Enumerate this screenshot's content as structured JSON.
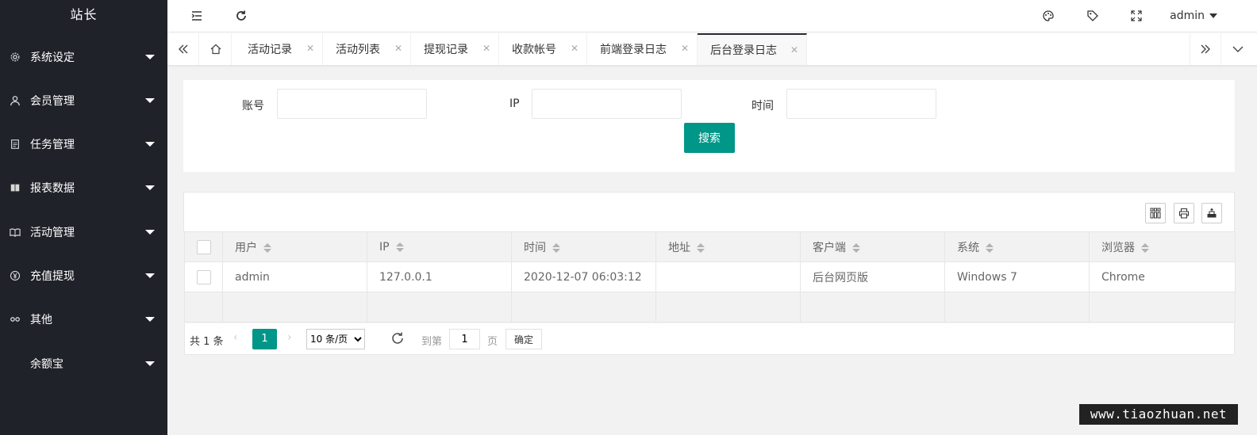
{
  "sidebar": {
    "logo": "站长",
    "items": [
      {
        "label": "系统设定",
        "icon": "gear-icon"
      },
      {
        "label": "会员管理",
        "icon": "user-icon"
      },
      {
        "label": "任务管理",
        "icon": "document-icon"
      },
      {
        "label": "报表数据",
        "icon": "book-icon"
      },
      {
        "label": "活动管理",
        "icon": "open-book-icon"
      },
      {
        "label": "充值提现",
        "icon": "yen-icon"
      },
      {
        "label": "其他",
        "icon": "link-icon"
      },
      {
        "label": "余额宝",
        "icon": ""
      }
    ]
  },
  "header": {
    "user": "admin",
    "icons": [
      "menu-fold-icon",
      "refresh-icon",
      "theme-icon",
      "tag-icon",
      "fullscreen-icon"
    ]
  },
  "tabs": [
    {
      "label": "活动记录",
      "active": false
    },
    {
      "label": "活动列表",
      "active": false
    },
    {
      "label": "提现记录",
      "active": false
    },
    {
      "label": "收款帐号",
      "active": false
    },
    {
      "label": "前端登录日志",
      "active": false
    },
    {
      "label": "后台登录日志",
      "active": true
    }
  ],
  "search": {
    "account_label": "账号",
    "account_value": "",
    "ip_label": "IP",
    "ip_value": "",
    "time_label": "时间",
    "time_value": "",
    "button": "搜索"
  },
  "table": {
    "columns": [
      "用户",
      "IP",
      "时间",
      "地址",
      "客户端",
      "系统",
      "浏览器"
    ],
    "rows": [
      [
        "admin",
        "127.0.0.1",
        "2020-12-07 06:03:12",
        "",
        "后台网页版",
        "Windows 7",
        "Chrome"
      ]
    ]
  },
  "pager": {
    "total": "共 1 条",
    "current": "1",
    "page_size": "10 条/页",
    "page_size_options": [
      "10 条/页"
    ],
    "goto_label": "到第",
    "goto_value": "1",
    "page_unit": "页",
    "confirm": "确定"
  },
  "watermark": "www.tiaozhuan.net",
  "colors": {
    "sidebar": "#20222a",
    "accent": "#009688"
  }
}
